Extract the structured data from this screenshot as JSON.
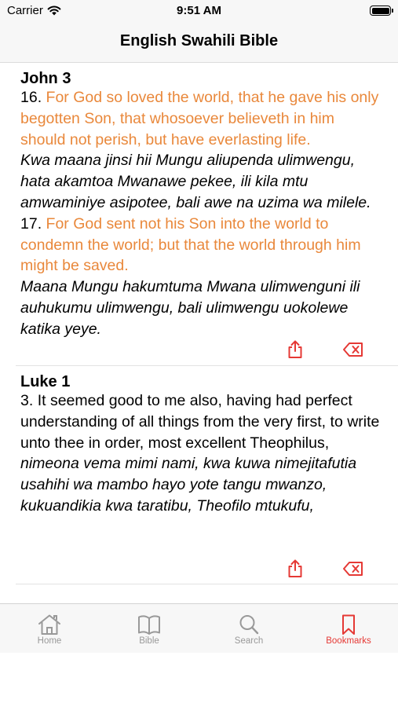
{
  "status_bar": {
    "carrier": "Carrier",
    "time": "9:51 AM"
  },
  "header": {
    "title": "English Swahili Bible"
  },
  "bookmarks": [
    {
      "reference": "John 3",
      "verse1_number": "16. ",
      "verse1_english": "For God so loved the world, that he gave his only begotten Son, that whosoever believeth in him should not perish, but have everlasting life.",
      "verse1_swahili": " Kwa maana jinsi hii Mungu aliupenda ulimwengu, hata akamtoa Mwanawe pekee, ili kila mtu amwaminiye asipotee, bali awe na uzima wa milele.",
      "verse2_number": " 17. ",
      "verse2_english": "For God sent not his Son into the world to condemn the world; but that the world through him might be saved.",
      "verse2_swahili": " Maana Mungu hakumtuma Mwana ulimwenguni ili auhukumu ulimwengu, bali ulimwengu uokolewe katika yeye."
    },
    {
      "reference": "Luke 1",
      "verse1_number": "3. ",
      "verse1_english": "It seemed good to me also, having had perfect understanding of all things from the very first, to write unto thee in order, most excellent Theophilus,",
      "verse1_swahili": " nimeona vema mimi nami, kwa kuwa nimejitafutia usahihi wa mambo hayo yote tangu mwanzo, kukuandikia kwa taratibu, Theofilo mtukufu,"
    }
  ],
  "tabs": [
    {
      "label": "Home",
      "icon": "home-icon"
    },
    {
      "label": "Bible",
      "icon": "book-icon"
    },
    {
      "label": "Search",
      "icon": "search-icon"
    },
    {
      "label": "Bookmarks",
      "icon": "bookmark-icon",
      "active": true
    }
  ],
  "colors": {
    "accent": "#e53935",
    "english_verse": "#e9883b",
    "tab_inactive": "#999999",
    "bar_background": "#f7f7f7"
  }
}
